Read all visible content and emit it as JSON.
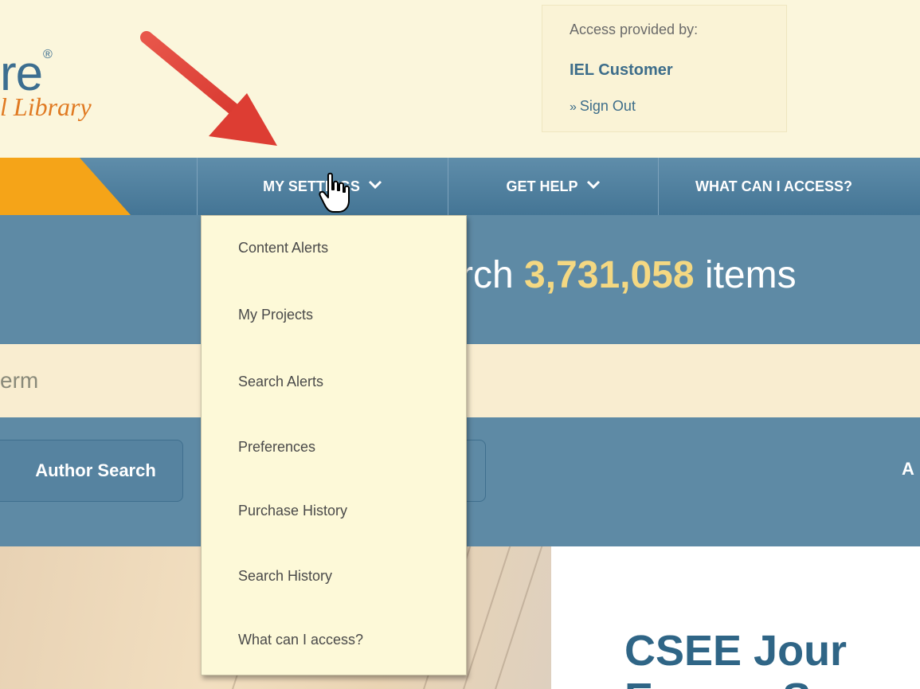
{
  "header": {
    "logo_re": "re",
    "logo_reg": "®",
    "logo_library": "l Library",
    "access": {
      "label": "Access provided by:",
      "name": "IEL Customer",
      "signout_prefix": "»",
      "signout": "Sign Out"
    }
  },
  "nav": {
    "items": [
      {
        "label": "MY SETTINGS",
        "icon": "chevron-down-icon"
      },
      {
        "label": "GET HELP",
        "icon": "chevron-down-icon"
      },
      {
        "label": "WHAT CAN I ACCESS?"
      }
    ],
    "chevron": "⌵"
  },
  "banner": {
    "prefix": "rch ",
    "count": "3,731,058",
    "suffix": " items"
  },
  "search": {
    "term_partial": "erm"
  },
  "options": {
    "author_search": "Author Search",
    "right_partial": "A"
  },
  "dropdown": {
    "items": [
      "Content Alerts",
      "My Projects",
      "Search Alerts",
      "Preferences",
      "Purchase History",
      "Search History",
      "What can I access?"
    ]
  },
  "content": {
    "heading_line1": "CSEE Jour",
    "heading_line2": "Energy S"
  },
  "colors": {
    "nav": "#4f7f9e",
    "banner": "#5e8aa5",
    "accent_orange": "#f5a418",
    "count_yellow": "#f4d882",
    "arrow_red": "#e3443a"
  }
}
